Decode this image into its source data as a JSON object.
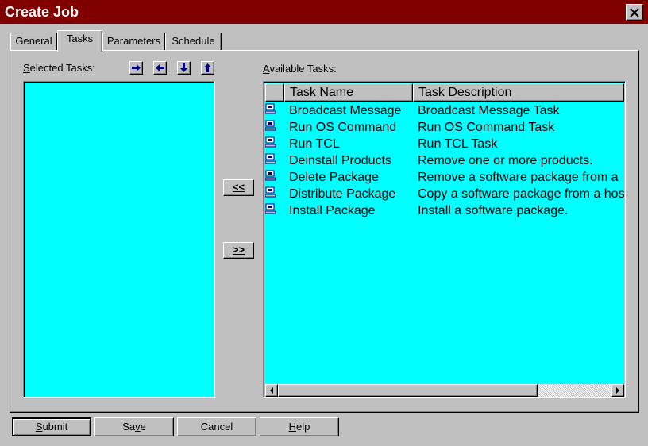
{
  "window": {
    "title": "Create Job"
  },
  "tabs": [
    {
      "label": "General"
    },
    {
      "label": "Tasks",
      "active": true
    },
    {
      "label": "Parameters"
    },
    {
      "label": "Schedule"
    }
  ],
  "selected_tasks": {
    "label_accel": "S",
    "label_rest": "elected Tasks:",
    "arrow_icons": [
      "arrow-right-icon",
      "arrow-left-icon",
      "arrow-down-icon",
      "arrow-up-icon"
    ],
    "items": []
  },
  "move_buttons": {
    "add_label": "<<",
    "remove_label": ">>"
  },
  "available_tasks": {
    "label_accel": "A",
    "label_rest": "vailable Tasks:",
    "columns": [
      "Task Name",
      "Task Description"
    ],
    "rows": [
      {
        "name": "Broadcast Message",
        "description": "Broadcast Message Task"
      },
      {
        "name": "Run OS Command",
        "description": "Run OS Command Task"
      },
      {
        "name": "Run TCL",
        "description": "Run TCL Task"
      },
      {
        "name": "Deinstall Products",
        "description": "Remove one or more products."
      },
      {
        "name": "Delete Package",
        "description": "Remove a software package from a"
      },
      {
        "name": "Distribute Package",
        "description": "Copy a software package from a hos"
      },
      {
        "name": "Install Package",
        "description": "Install a software package."
      }
    ],
    "row_icon": "computer-icon"
  },
  "buttons": [
    {
      "name": "submit-button",
      "accel": "S",
      "rest": "ubmit"
    },
    {
      "name": "save-button",
      "pre": "Sa",
      "accel": "v",
      "rest": "e"
    },
    {
      "name": "cancel-button",
      "rest": "Cancel"
    },
    {
      "name": "help-button",
      "accel": "H",
      "rest": "elp"
    }
  ],
  "colors": {
    "titlebar": "#800000",
    "list_bg": "#00ffff",
    "face": "#c0c0c0",
    "arrow": "#000080"
  }
}
